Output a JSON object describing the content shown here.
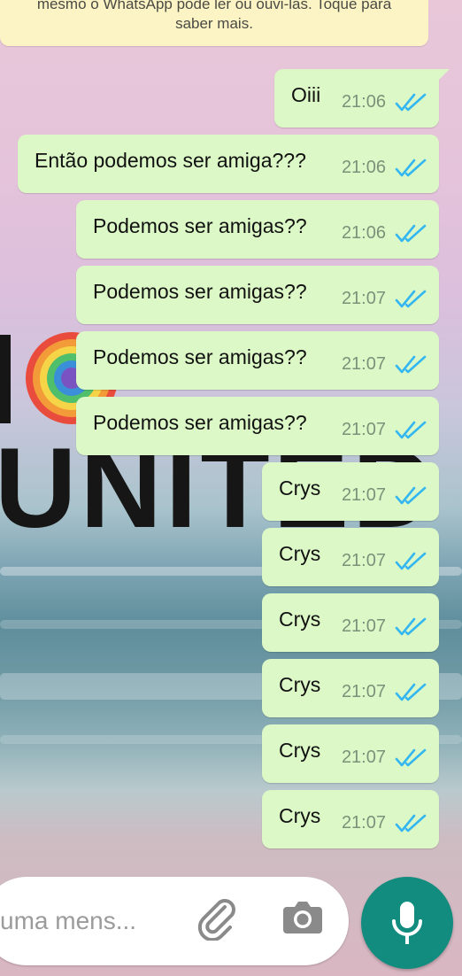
{
  "security_notice": {
    "line1": "mesmo o WhatsApp pode ler ou ouvi-las. Toque para",
    "line2": "saber mais."
  },
  "messages": [
    {
      "text": "Oiii",
      "time": "21:06",
      "status": "read"
    },
    {
      "text": "Então podemos ser amiga???",
      "time": "21:06",
      "status": "read"
    },
    {
      "text": "Podemos ser amigas??",
      "time": "21:06",
      "status": "read"
    },
    {
      "text": "Podemos ser amigas??",
      "time": "21:07",
      "status": "read"
    },
    {
      "text": "Podemos ser amigas??",
      "time": "21:07",
      "status": "read"
    },
    {
      "text": "Podemos ser amigas??",
      "time": "21:07",
      "status": "read"
    },
    {
      "text": "Crys",
      "time": "21:07",
      "status": "read"
    },
    {
      "text": "Crys",
      "time": "21:07",
      "status": "read"
    },
    {
      "text": "Crys",
      "time": "21:07",
      "status": "read"
    },
    {
      "text": "Crys",
      "time": "21:07",
      "status": "read"
    },
    {
      "text": "Crys",
      "time": "21:07",
      "status": "read"
    },
    {
      "text": "Crys",
      "time": "21:07",
      "status": "read"
    }
  ],
  "wallpaper": {
    "text": "UNITED"
  },
  "composer": {
    "placeholder": "uma mens..."
  },
  "icons": {
    "attach": "paperclip-icon",
    "camera": "camera-icon",
    "mic": "microphone-icon",
    "read_receipt": "double-check-icon"
  },
  "colors": {
    "outgoing_bubble": "#dcf8c6",
    "read_tick": "#34b7f1",
    "mic_button": "#128c7e",
    "notice_bg": "#fdf4c5"
  }
}
